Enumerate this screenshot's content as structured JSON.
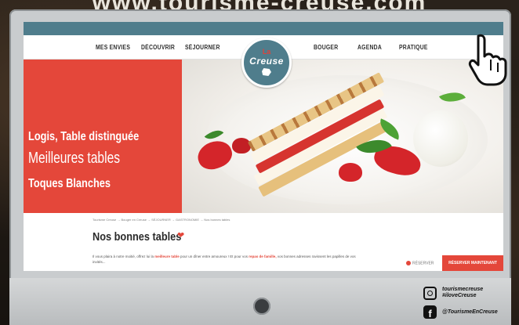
{
  "banner": {
    "text": "www.tourisme-creuse.com"
  },
  "site": {
    "nav_left": [
      "MES ENVIES",
      "DÉCOUVRIR",
      "SÉJOURNER"
    ],
    "nav_right": [
      "BOUGER",
      "AGENDA",
      "PRATIQUE"
    ],
    "logo": {
      "prefix": "La",
      "name": "Creuse"
    }
  },
  "hero": {
    "lines": [
      "Logis, Table distinguée",
      "Meilleures tables",
      "Toques Blanches"
    ],
    "accent_color": "#e4473a"
  },
  "content": {
    "breadcrumb": "Tourisme Creuse → Bouger en Creuse → SÉJOURNER → GASTRONOMIE → Nos bonnes tables",
    "title": "Nos bonnes tables",
    "intro_start": "Il vous plaira à notre moitié, offrez lui la ",
    "intro_bold1": "meilleure table",
    "intro_mid": " pour un dîner entre amoureux ! Et pour vos ",
    "intro_bold2": "repas de famille,",
    "intro_end": " vos bonnes adresses ravissent les papilles de vos invités...",
    "reserve_label": "RÉSERVER",
    "cta_label": "RÉSERVER MAINTENANT"
  },
  "social": {
    "instagram": [
      "tourismecreuse",
      "#iloveCreuse"
    ],
    "facebook": "@TourismeEnCreuse"
  }
}
